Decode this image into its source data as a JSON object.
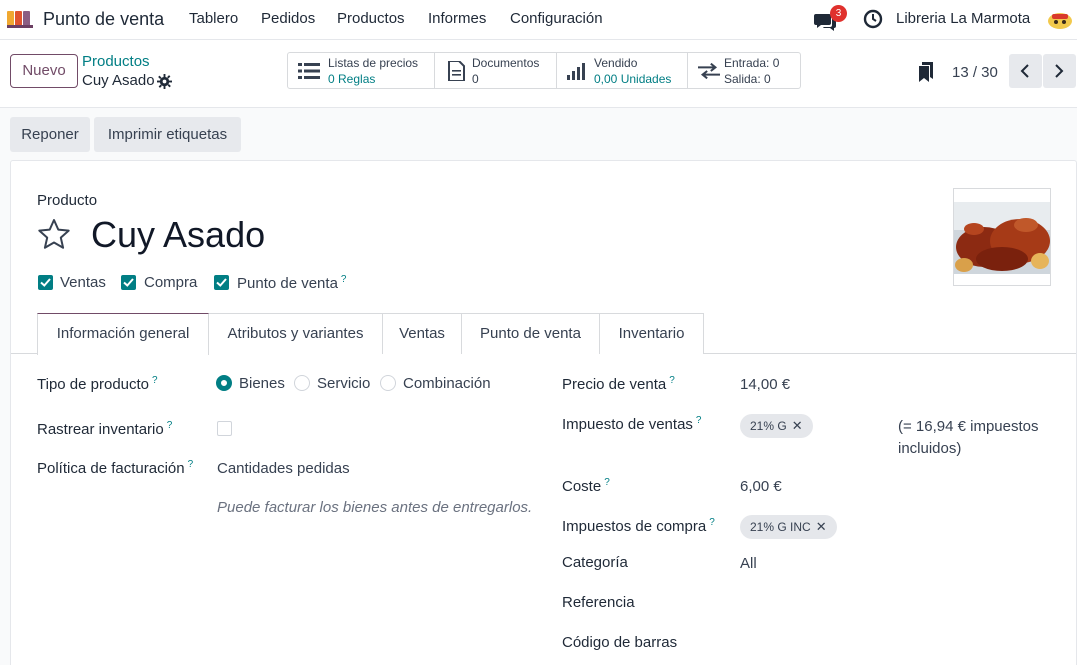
{
  "navbar": {
    "app_name": "Punto de venta",
    "menu": [
      "Tablero",
      "Pedidos",
      "Productos",
      "Informes",
      "Configuración"
    ],
    "chat_count": "3",
    "company": "Libreria La Marmota"
  },
  "control": {
    "new_label": "Nuevo",
    "breadcrumb_parent": "Productos",
    "breadcrumb_current": "Cuy Asado",
    "smart_buttons": [
      {
        "title": "Listas de precios",
        "value": "0  Reglas",
        "icon": "list-icon"
      },
      {
        "title": "Documentos",
        "value": "0",
        "icon": "document-icon"
      },
      {
        "title": "Vendido",
        "value": "0,00 Unidades",
        "icon": "chart-bars-icon"
      },
      {
        "title": "Entrada: 0",
        "value": "Salida: 0",
        "icon": "transfer-arrows-icon"
      }
    ],
    "pager": "13 / 30"
  },
  "actions": {
    "replenish": "Reponer",
    "print_labels": "Imprimir etiquetas"
  },
  "form": {
    "type_label": "Producto",
    "name": "Cuy Asado",
    "checks": [
      {
        "label": "Ventas",
        "checked": true
      },
      {
        "label": "Compra",
        "checked": true
      },
      {
        "label": "Punto de venta",
        "checked": true
      }
    ],
    "help_mark": "?",
    "tabs": [
      "Información general",
      "Atributos y variantes",
      "Ventas",
      "Punto de venta",
      "Inventario"
    ],
    "left": {
      "product_type_label": "Tipo de producto",
      "product_type_options": [
        "Bienes",
        "Servicio",
        "Combinación"
      ],
      "product_type_selected": "Bienes",
      "track_inventory_label": "Rastrear inventario",
      "track_inventory_checked": false,
      "invoice_policy_label": "Política de facturación",
      "invoice_policy_value": "Cantidades pedidas",
      "invoice_policy_hint": "Puede facturar los bienes antes de entregarlos."
    },
    "right": {
      "sale_price_label": "Precio de venta",
      "sale_price": "14,00 €",
      "sales_tax_label": "Impuesto de ventas",
      "sales_tax_tag": "21% G",
      "tax_included": "(= 16,94 € impuestos incluidos)",
      "cost_label": "Coste",
      "cost": "6,00 €",
      "purchase_tax_label": "Impuestos de compra",
      "purchase_tax_tag": "21% G INC",
      "category_label": "Categoría",
      "category": "All",
      "reference_label": "Referencia",
      "barcode_label": "Código de barras"
    }
  },
  "colors": {
    "brand": "#714b67",
    "accent": "#017e84",
    "badge": "#e0312d"
  }
}
